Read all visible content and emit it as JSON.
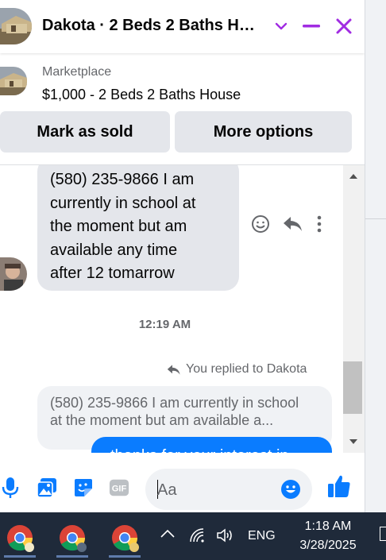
{
  "header": {
    "title": "Dakota · 2 Beds 2 Baths H…",
    "accent": "#a12ce2"
  },
  "marketplace": {
    "label": "Marketplace",
    "title": "$1,000 - 2 Beds 2 Baths House",
    "mark_sold": "Mark as sold",
    "more_options": "More options"
  },
  "messages": {
    "incoming_lines": [
      "(580) 235-9866 I am",
      "currently in school at",
      "the moment but am",
      "available any time",
      "after 12 tomarrow"
    ],
    "timestamp": "12:19 AM",
    "replied_label": "You replied to Dakota",
    "quote_lines": [
      "(580) 235-9866 I am currently in school",
      "at the moment but am available a..."
    ],
    "sent_partial": "thanks for your interest in"
  },
  "composer": {
    "placeholder": "Aa",
    "accent": "#0a7cff"
  },
  "taskbar": {
    "language": "ENG",
    "time": "1:18 AM",
    "date": "3/28/2025"
  }
}
